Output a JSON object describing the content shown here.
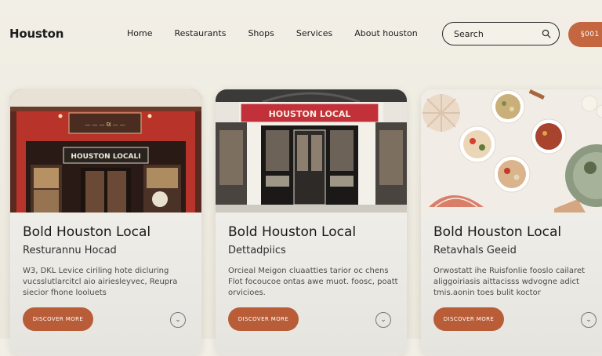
{
  "header": {
    "logo": "Houston",
    "nav": [
      "Home",
      "Restaurants",
      "Shops",
      "Services",
      "About houston"
    ],
    "search_placeholder": "Search",
    "cta_label": "§001"
  },
  "cards": [
    {
      "sign_text": "HOUSTON LOCALI",
      "title": "Bold Houston Local",
      "subtitle": "Resturannu Hocad",
      "description": "W3, DKL Levice ciriling hote dicluring vucsslutlarcitcl aio airiesleyvec, Reupra siecior fhone looluets",
      "button": "DISCOVER MORE"
    },
    {
      "sign_text": "HOUSTON LOCAL",
      "title": "Bold Houston Local",
      "subtitle": "Dettadpiics",
      "description": "Orcieal Meigon cluaatties tarior oc chens Flot focoucoe ontas awe muot. foosc, poatt orvicioes.",
      "button": "DISCOVER MORE"
    },
    {
      "title": "Bold Houston Local",
      "subtitle": "Retavhals Geeid",
      "description": "Orwostatt ihe Ruisfonlie fooslo cailaret aliggoiriasis aittacisss wdvogne adict tmis.aonin toes bulit koctor",
      "button": "DISCOVER MORE"
    }
  ],
  "colors": {
    "accent": "#c4663f",
    "background": "#f0ede4"
  }
}
